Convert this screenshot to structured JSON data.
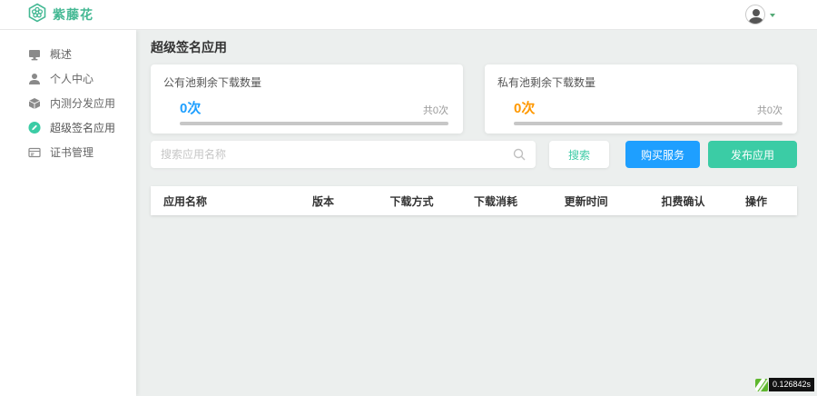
{
  "header": {
    "logo_text": "紫藤花"
  },
  "sidebar": {
    "items": [
      {
        "label": "概述",
        "icon": "monitor-icon"
      },
      {
        "label": "个人中心",
        "icon": "user-icon"
      },
      {
        "label": "内测分发应用",
        "icon": "package-icon"
      },
      {
        "label": "超级签名应用",
        "icon": "signature-icon",
        "active": true
      },
      {
        "label": "证书管理",
        "icon": "certificate-icon"
      }
    ]
  },
  "main": {
    "page_title": "超级签名应用",
    "stat_cards": [
      {
        "label": "公有池剩余下载数量",
        "value": "0次",
        "total": "共0次",
        "value_color": "#1E9FFF"
      },
      {
        "label": "私有池剩余下载数量",
        "value": "0次",
        "total": "共0次",
        "value_color": "#FF9800"
      }
    ],
    "search": {
      "placeholder": "搜索应用名称"
    },
    "buttons": {
      "search": "搜索",
      "buy": "购买服务",
      "publish": "发布应用"
    },
    "table": {
      "headers": [
        "应用名称",
        "版本",
        "下载方式",
        "下载消耗",
        "更新时间",
        "扣费确认",
        "操作"
      ]
    },
    "trace_badge": "0.126842s"
  },
  "colors": {
    "brand_teal": "#43B893",
    "button_blue": "#1E9FFF",
    "button_teal": "#3BCCA5",
    "value_blue": "#1E9FFF",
    "value_orange": "#FF9800",
    "trace_green": "#5FB72F",
    "background": "#ECEFEE"
  }
}
